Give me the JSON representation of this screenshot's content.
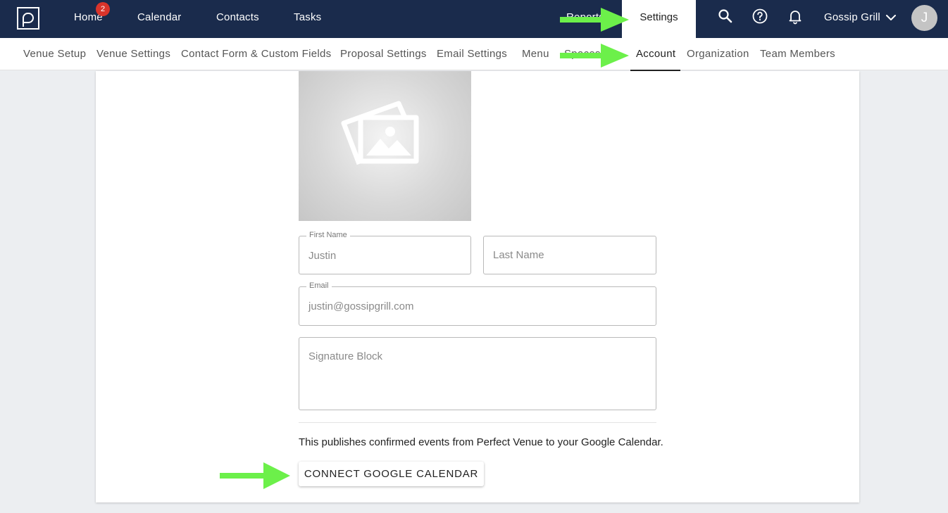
{
  "topnav": {
    "home": "Home",
    "home_badge": "2",
    "calendar": "Calendar",
    "contacts": "Contacts",
    "tasks": "Tasks",
    "reports": "Reports",
    "settings": "Settings",
    "account_name": "Gossip Grill",
    "avatar_initial": "J",
    "icons": [
      "search-icon",
      "help-icon",
      "bell-icon",
      "chevron-down-icon"
    ]
  },
  "subnav": {
    "items": [
      "Venue Setup",
      "Venue Settings",
      "Contact Form & Custom Fields",
      "Proposal Settings",
      "Email Settings",
      "Menu",
      "Spaces",
      "Account",
      "Organization",
      "Team Members"
    ],
    "active": "Account"
  },
  "form": {
    "first_name": {
      "label": "First Name",
      "value": "Justin"
    },
    "last_name": {
      "placeholder": "Last Name"
    },
    "email": {
      "label": "Email",
      "value": "justin@gossipgrill.com"
    },
    "signature": {
      "placeholder": "Signature Block"
    }
  },
  "google_calendar": {
    "description": "This publishes confirmed events from Perfect Venue to your Google Calendar.",
    "button": "CONNECT GOOGLE CALENDAR"
  },
  "colors": {
    "topbar": "#1a2b4c",
    "badge": "#d9342b",
    "annotation_arrow": "#6cf04a"
  }
}
